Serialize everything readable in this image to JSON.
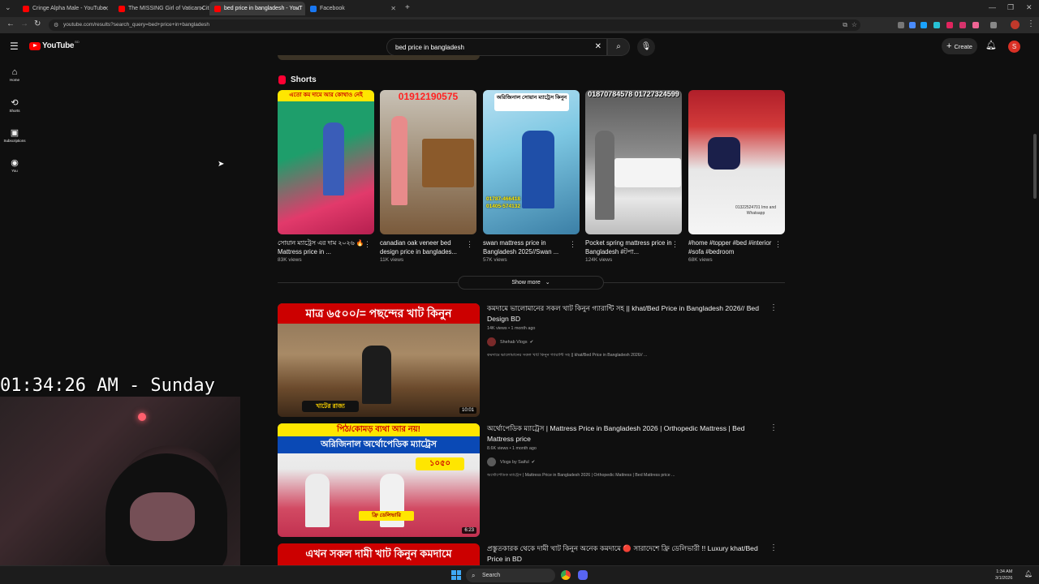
{
  "browser": {
    "tabs": [
      {
        "title": "Cringe Alpha Male - YouTube",
        "color": "#ff0000"
      },
      {
        "title": "The MISSING Girl of Vatican Cit",
        "color": "#ff0000"
      },
      {
        "title": "bed price in bangladesh - YouT",
        "color": "#ff0000"
      },
      {
        "title": "Facebook",
        "color": "#1877f2"
      }
    ],
    "url": "youtube.com/results?search_query=bed+price+in+bangladesh"
  },
  "header": {
    "logo_text": "YouTube",
    "country_code": "BD",
    "search_value": "bed price in bangladesh",
    "create_label": "Create",
    "avatar_letter": "S"
  },
  "sidebar": {
    "items": [
      {
        "label": "Home",
        "icon": "home-icon"
      },
      {
        "label": "Shorts",
        "icon": "shorts-icon"
      },
      {
        "label": "Subscriptions",
        "icon": "subscriptions-icon"
      },
      {
        "label": "You",
        "icon": "you-icon"
      }
    ]
  },
  "shorts_section": {
    "heading": "Shorts",
    "show_more": "Show more",
    "items": [
      {
        "title": "সোয়ান ম্যাট্রেস এর দাম ২০২৬ 🔥 Mattress price in ...",
        "views": "83K views",
        "overlay": "এতো কম দামে আর কোথাও নেই"
      },
      {
        "title": "canadian oak veneer bed design price in banglades...",
        "views": "11K views",
        "overlay": "01912190575"
      },
      {
        "title": "swan mattress price in Bangladesh 2025//Swan ...",
        "views": "57K views",
        "overlay": "অরিজিনাল সোয়ান ম্যাট্রেস কিনুন",
        "phones": "01787-466418 01405-574132"
      },
      {
        "title": "Pocket spring mattress price in Bangladesh #টপা...",
        "views": "124K views",
        "overlay": "01870784578 01727324599"
      },
      {
        "title": "#home #topper #bed #interior #sofa #bedroom",
        "views": "68K views",
        "overlay": "01322524701 Imo and Whatsapp"
      }
    ]
  },
  "videos": [
    {
      "title": "কমদামে ভালোমানের সকল খাট কিনুন গ্যারান্টি সহ || khat/Bed Price in Bangladesh 2026// Bed Design BD",
      "meta": "14K views • 1 month ago",
      "channel": "Shehab Vlogs",
      "desc": "কমদামে ভালোমানের সকল খাট কিনুন গ্যারান্টি সহ || khat/Bed Price in Bangladesh 2026// ...",
      "duration": "10:01",
      "thumb_top": "মাত্র ৬৫০০/= পছন্দের খাট কিনুন",
      "thumb_bottom": "খাটের রাজ্য"
    },
    {
      "title": "অর্থোপেডিক ম্যাট্রেস | Mattress Price in Bangladesh 2026 | Orthopedic Mattress | Bed Mattress price",
      "meta": "8.6K views • 1 month ago",
      "channel": "Vlogs by Saiful",
      "desc": "অর্থোপেডিক ম্যাট্রেস | Mattress Price in Bangladesh 2026 | Orthopedic Mattress | Bed Mattress price ...",
      "duration": "6:23",
      "thumb_top": "পিঠ/কোমড় ব্যথা আর নয়!",
      "thumb_mid": "অরিজিনাল অর্থোপেডিক ম্যাট্রেস",
      "thumb_price": "১০৫০",
      "thumb_tag": "ফ্রি ডেলিভারি"
    },
    {
      "title": "প্রস্তুতকারক থেকে দামী খাট কিনুন অনেক কমদামে 🔴 সারাদেশে ফ্রি ডেলিভারী !! Luxury khat/Bed Price in BD",
      "thumb_top": "এখন সকল দামী খাট কিনুন কমদামে"
    }
  ],
  "overlay": {
    "clock": "01:34:26 AM - Sunday"
  },
  "taskbar": {
    "search_label": "Search",
    "time": "1:34 AM",
    "date": "3/1/2026"
  }
}
